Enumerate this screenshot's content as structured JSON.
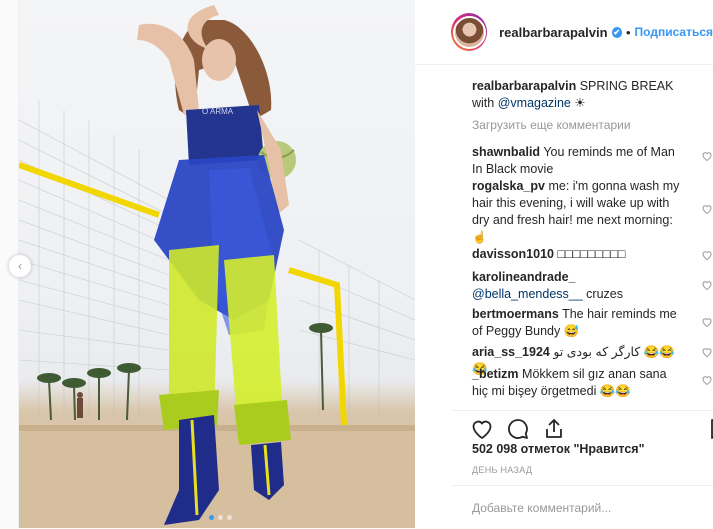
{
  "post": {
    "username": "realbarbarapalvin",
    "verified_mark": "✔",
    "separator": "•",
    "follow_label": "Подписаться"
  },
  "caption": {
    "username": "realbarbarapalvin",
    "text": "SPRING BREAK with",
    "mention": "@vmagazine",
    "emoji": "☀"
  },
  "load_more_label": "Загрузить еще комментарии",
  "comments": [
    {
      "user": "shawnbalid",
      "text": "You reminds me of Man In Black movie"
    },
    {
      "user": "rogalska_pv",
      "text": "me: i'm gonna wash my hair this evening, i will wake up with dry and fresh hair! me next morning:"
    },
    {
      "user": "davisson1010",
      "text": "□□□□□□□□□"
    },
    {
      "user": "karolineandrade_",
      "mention": "@bella_mendess__",
      "text": "cruzes"
    },
    {
      "user": "bertmoermans",
      "text": "The hair reminds me of Peggy Bundy 😅"
    },
    {
      "user": "aria_ss_1924",
      "text": "کارگر که بودی تو 😂😂😂"
    },
    {
      "user": "_betizm",
      "text": "Mökkem sil gız anan sana hiç mi bişey örgetmedi 😂😂"
    }
  ],
  "likes_label": "502 098 отметок \"Нравится\"",
  "time_label": "ДЕНЬ НАЗАД",
  "add_comment_placeholder": "Добавьте комментарий...",
  "icons": {
    "like": "heart-icon",
    "comment": "comment-icon",
    "share": "share-icon",
    "save": "bookmark-icon"
  },
  "colors": {
    "accent": "#3897f0",
    "text": "#262626",
    "muted": "#999999"
  }
}
